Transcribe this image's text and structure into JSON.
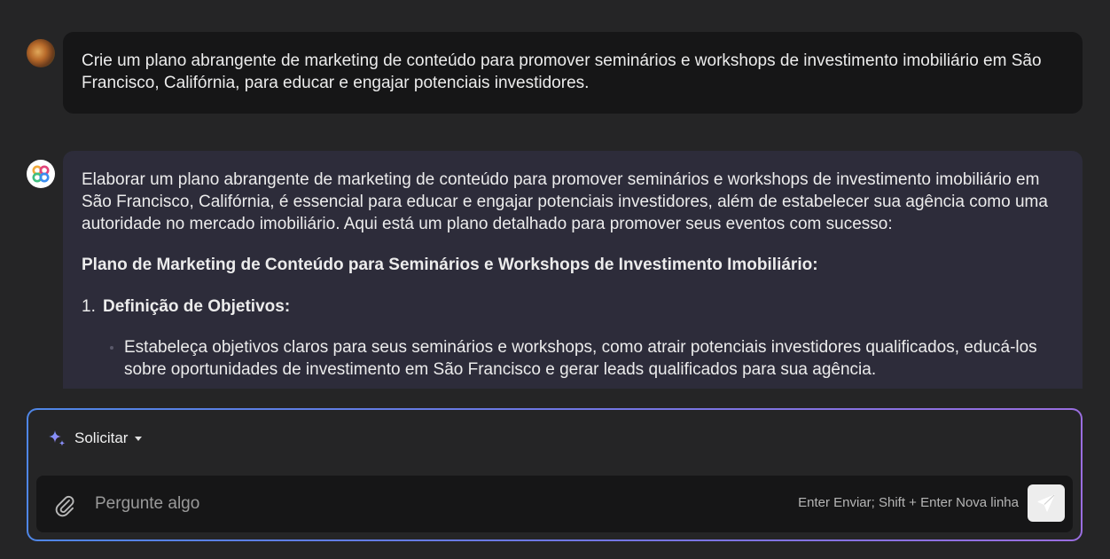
{
  "conversation": {
    "user_message": "Crie um plano abrangente de marketing de conteúdo para promover seminários e workshops de investimento imobiliário em São Francisco, Califórnia, para educar e engajar potenciais investidores.",
    "assistant_message": {
      "intro": "Elaborar um plano abrangente de marketing de conteúdo para promover seminários e workshops de investimento imobiliário em São Francisco, Califórnia, é essencial para educar e engajar potenciais investidores, além de estabelecer sua agência como uma autoridade no mercado imobiliário. Aqui está um plano detalhado para promover seus eventos com sucesso:",
      "heading": "Plano de Marketing de Conteúdo para Seminários e Workshops de Investimento Imobiliário:",
      "list_items": [
        {
          "number": "1.",
          "title": "Definição de Objetivos:",
          "bullets": [
            "Estabeleça objetivos claros para seus seminários e workshops, como atrair potenciais investidores qualificados, educá-los sobre oportunidades de investimento em São Francisco e gerar leads qualificados para sua agência."
          ]
        }
      ]
    }
  },
  "composer": {
    "mode_label": "Solicitar",
    "input_value": "",
    "input_placeholder": "Pergunte algo",
    "hint": "Enter Enviar; Shift + Enter Nova linha"
  },
  "icons": {
    "mode": "sparkle-icon",
    "mode_dropdown": "caret-down-icon",
    "attach": "paperclip-icon",
    "send": "send-icon"
  },
  "colors": {
    "background": "#252526",
    "user_bubble": "#161617",
    "assistant_bubble": "#2d2c3a",
    "composer_border_start": "#4f86e6",
    "composer_border_end": "#9a6ee0"
  }
}
